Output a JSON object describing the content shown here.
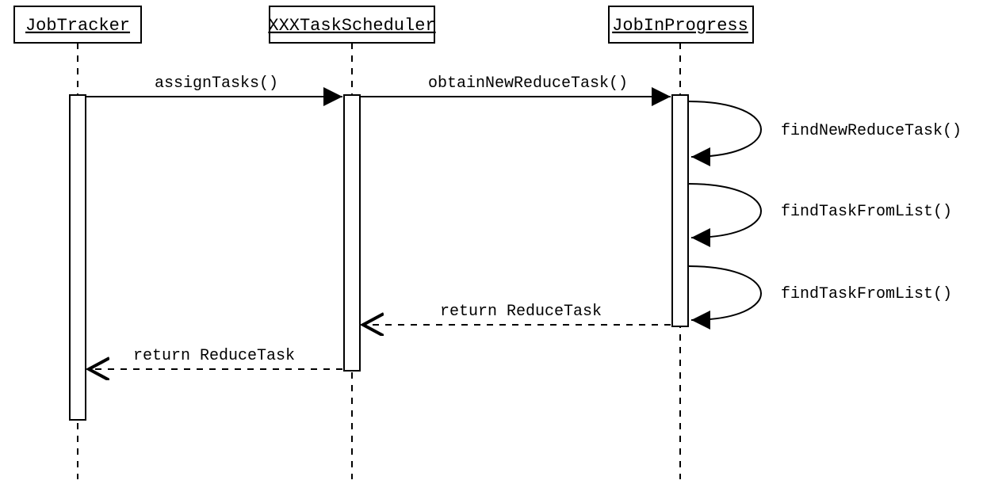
{
  "participants": {
    "p1": "JobTracker",
    "p2": "XXXTaskScheduler",
    "p3": "JobInProgress"
  },
  "messages": {
    "m1": "assignTasks()",
    "m2": "obtainNewReduceTask()",
    "self1": "findNewReduceTask()",
    "self2": "findTaskFromList()",
    "self3": "findTaskFromList()",
    "r1": "return ReduceTask",
    "r2": "return ReduceTask"
  }
}
